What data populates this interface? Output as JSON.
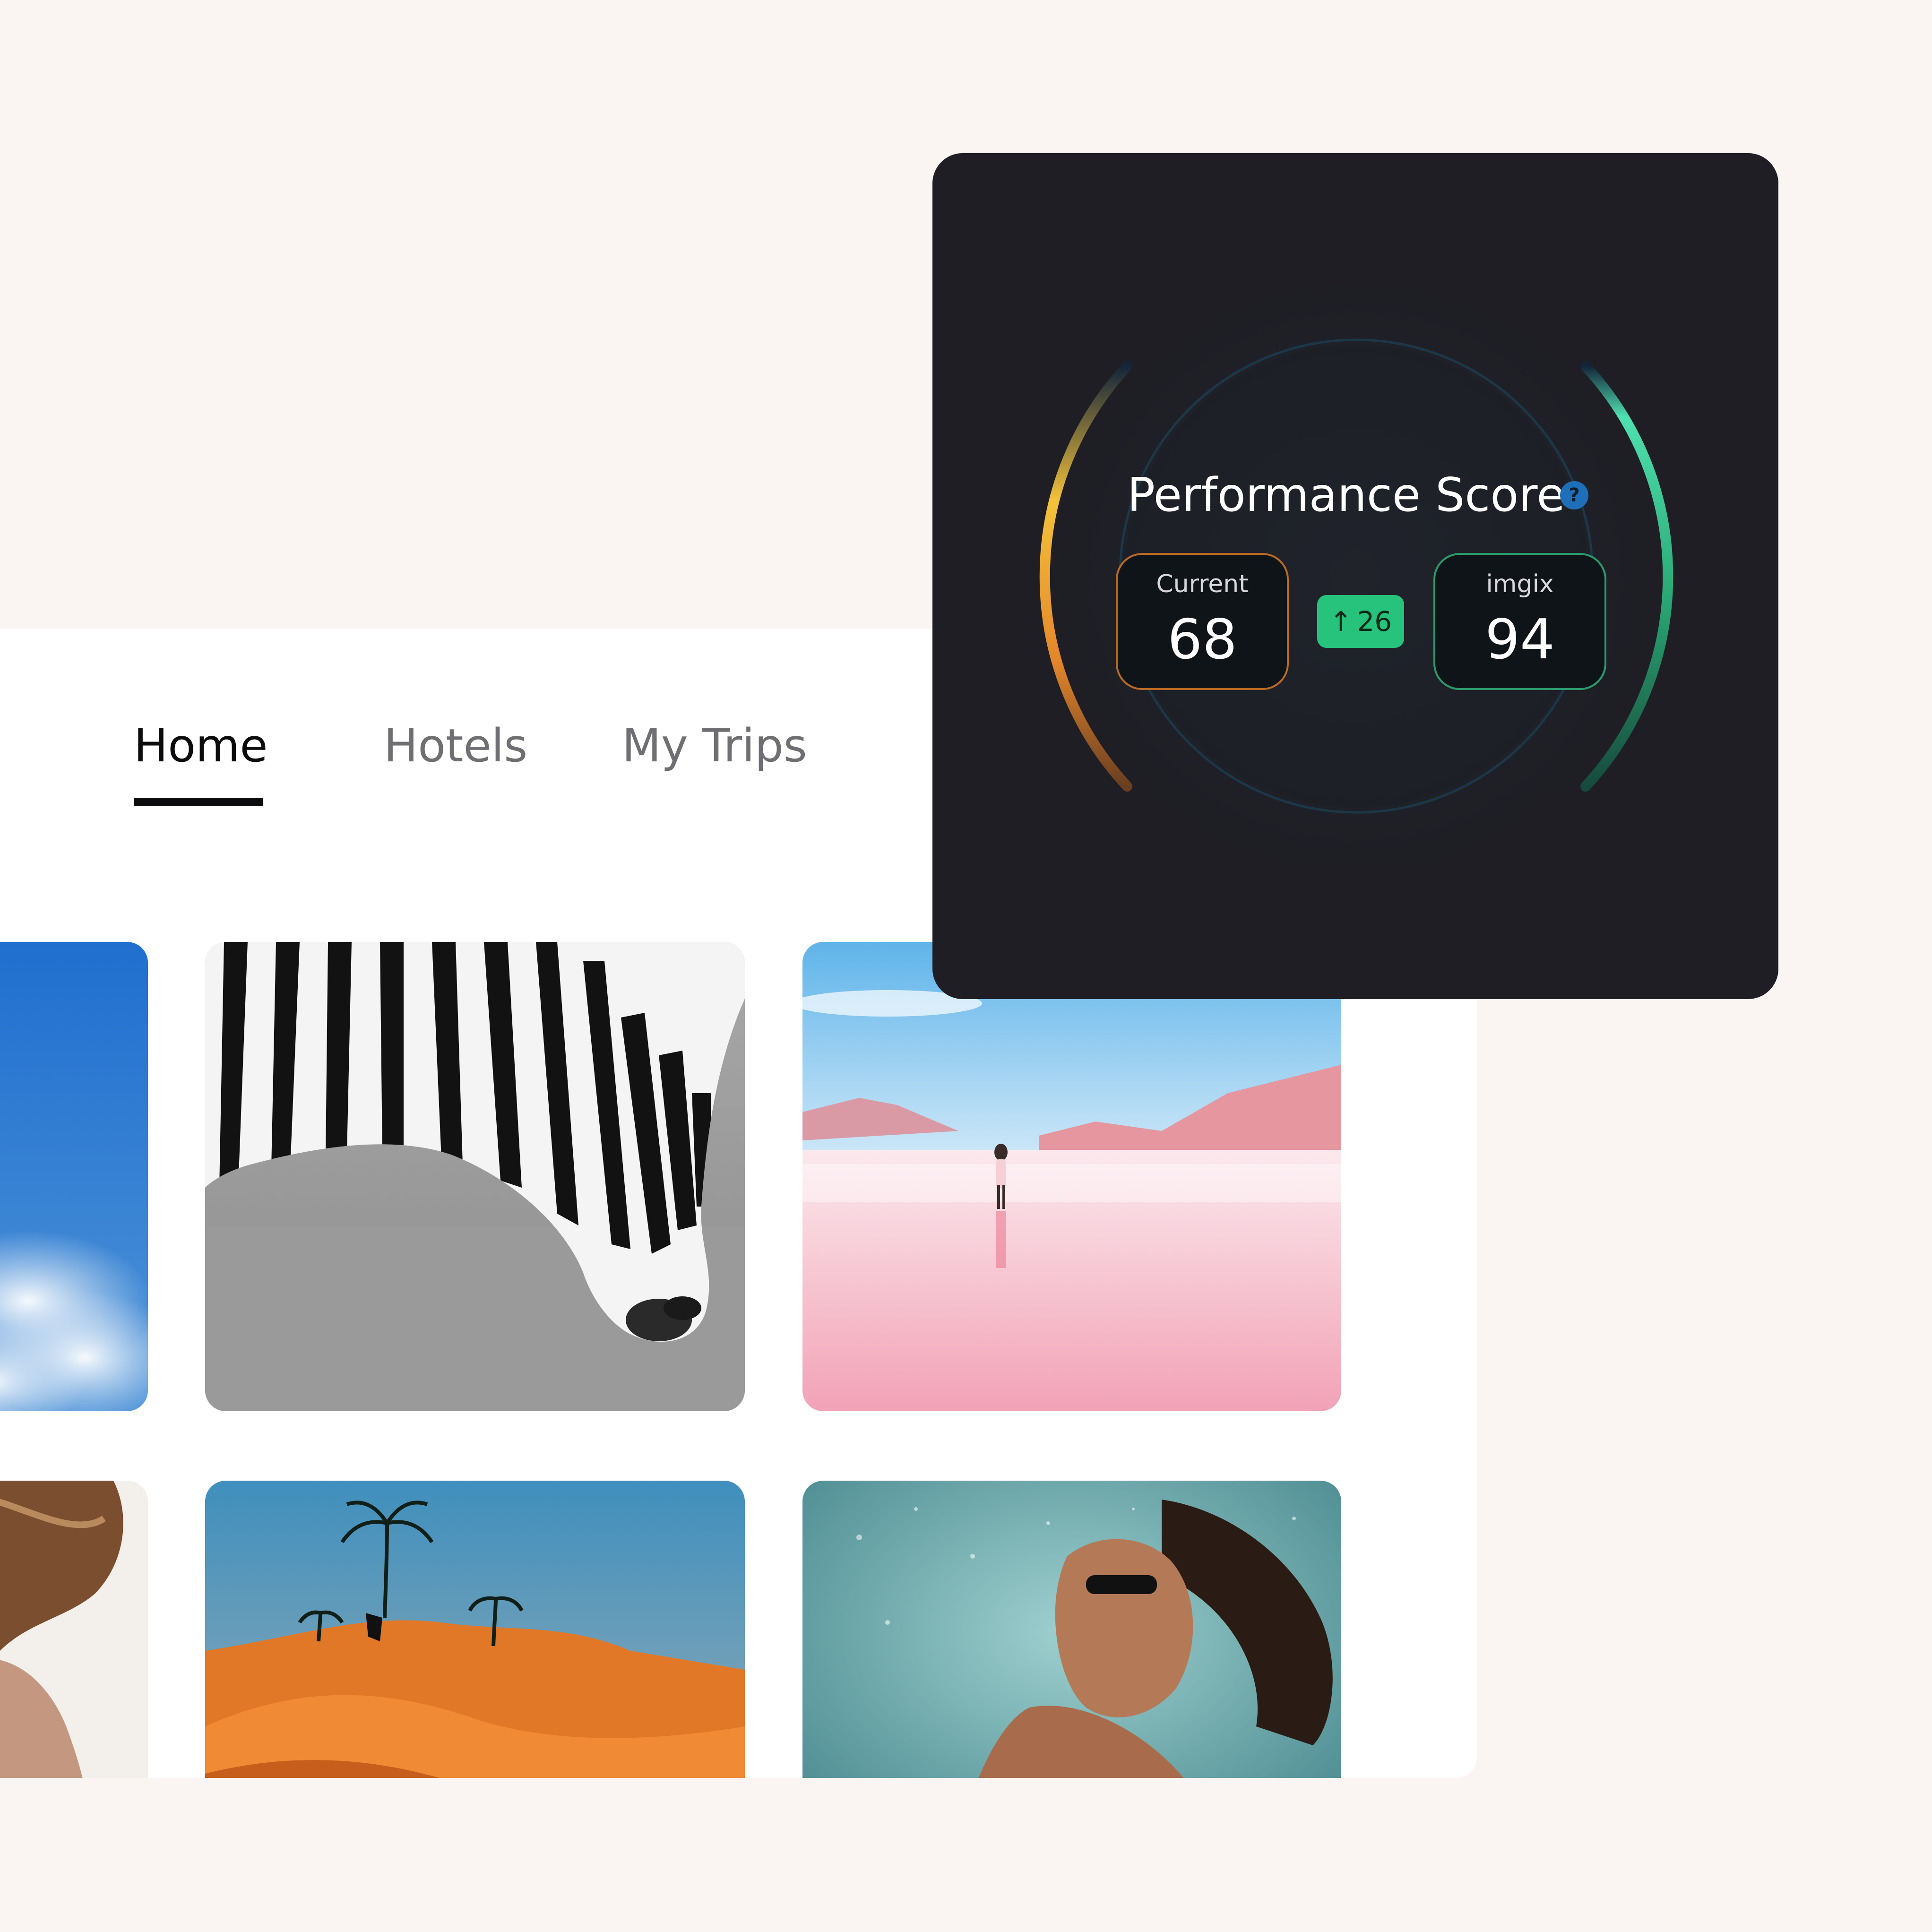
{
  "nav": {
    "tabs": [
      {
        "label": "Home"
      },
      {
        "label": "Hotels"
      },
      {
        "label": "My Trips"
      }
    ]
  },
  "performance": {
    "title": "Performance Score",
    "help_icon": "?",
    "current": {
      "label": "Current",
      "value": "68"
    },
    "imgix": {
      "label": "imgix",
      "value": "94"
    },
    "delta": {
      "arrow": "↑",
      "value": "26"
    }
  },
  "colors": {
    "page_bg": "#faf5f2",
    "card_bg": "#1e1e24",
    "current_accent": "#b86a24",
    "imgix_accent": "#2c9a6c",
    "delta_badge": "#27c27b",
    "help_icon": "#1f6fb8"
  },
  "icons": [
    "help-icon",
    "arrow-up-icon"
  ]
}
